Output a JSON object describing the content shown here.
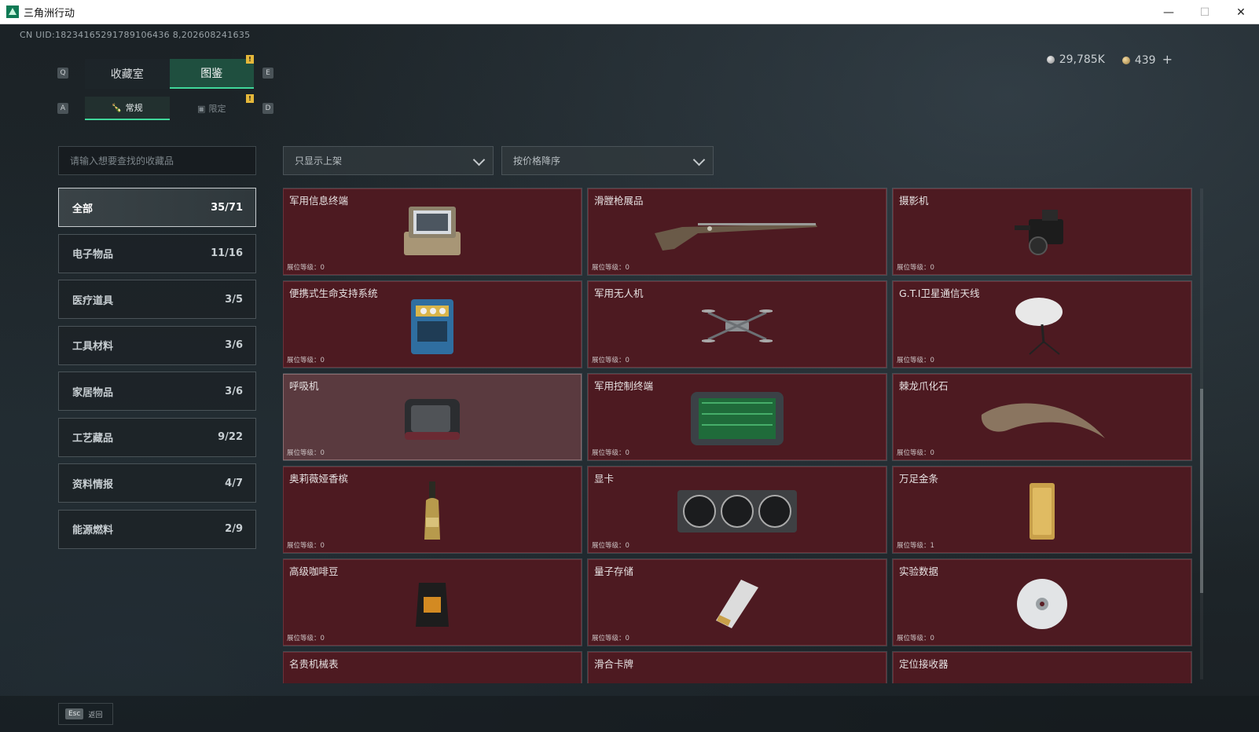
{
  "window": {
    "title": "三角洲行动",
    "minimize": "—",
    "maximize": "☐",
    "close": "✕"
  },
  "uid": "CN UID:18234165291789106436 8,202608241635",
  "currency": {
    "silver": "29,785K",
    "gold": "439",
    "add": "+"
  },
  "keys": {
    "q": "Q",
    "e": "E",
    "a": "A",
    "d": "D"
  },
  "tabs": [
    {
      "label": "收藏室",
      "active": false
    },
    {
      "label": "图鉴",
      "active": true
    }
  ],
  "tab_notice": "!",
  "subtabs": [
    {
      "label": "常规",
      "active": true
    },
    {
      "label": "限定",
      "active": false
    }
  ],
  "subtab_notice": "!",
  "search": {
    "placeholder": "请输入想要查找的收藏品"
  },
  "filters": {
    "shelf": "只显示上架",
    "sort": "按价格降序"
  },
  "categories": [
    {
      "label": "全部",
      "count": "35/71"
    },
    {
      "label": "电子物品",
      "count": "11/16"
    },
    {
      "label": "医疗道具",
      "count": "3/5"
    },
    {
      "label": "工具材料",
      "count": "3/6"
    },
    {
      "label": "家居物品",
      "count": "3/6"
    },
    {
      "label": "工艺藏品",
      "count": "9/22"
    },
    {
      "label": "资料情报",
      "count": "4/7"
    },
    {
      "label": "能源燃料",
      "count": "2/9"
    }
  ],
  "items": [
    {
      "name": "军用信息终端",
      "level": "展位等级：0",
      "icon": "terminal-case-icon"
    },
    {
      "name": "滑膛枪展品",
      "level": "展位等级：0",
      "icon": "musket-icon"
    },
    {
      "name": "摄影机",
      "level": "展位等级：0",
      "icon": "camera-icon"
    },
    {
      "name": "便携式生命支持系统",
      "level": "展位等级：0",
      "icon": "life-support-icon"
    },
    {
      "name": "军用无人机",
      "level": "展位等级：0",
      "icon": "drone-icon"
    },
    {
      "name": "G.T.I卫星通信天线",
      "level": "展位等级：0",
      "icon": "satellite-dish-icon"
    },
    {
      "name": "呼吸机",
      "level": "展位等级：0",
      "icon": "ventilator-icon"
    },
    {
      "name": "军用控制终端",
      "level": "展位等级：0",
      "icon": "control-terminal-icon"
    },
    {
      "name": "棘龙爪化石",
      "level": "展位等级：0",
      "icon": "claw-fossil-icon"
    },
    {
      "name": "奥莉薇娅香槟",
      "level": "展位等级：0",
      "icon": "champagne-icon"
    },
    {
      "name": "显卡",
      "level": "展位等级：0",
      "icon": "graphics-card-icon"
    },
    {
      "name": "万足金条",
      "level": "展位等级：1",
      "icon": "gold-bar-icon"
    },
    {
      "name": "高级咖啡豆",
      "level": "展位等级：0",
      "icon": "coffee-bag-icon"
    },
    {
      "name": "量子存储",
      "level": "展位等级：0",
      "icon": "quantum-storage-icon"
    },
    {
      "name": "实验数据",
      "level": "展位等级：0",
      "icon": "disc-icon"
    },
    {
      "name": "名贵机械表",
      "level": "",
      "icon": ""
    },
    {
      "name": "滑合卡牌",
      "level": "",
      "icon": ""
    },
    {
      "name": "定位接收器",
      "level": "",
      "icon": ""
    }
  ],
  "footer": {
    "esc": "Esc",
    "back": "返回"
  },
  "colors": {
    "card_bg": "#4d1a21",
    "card_highlight": "#5a3a3f",
    "accent": "#3fd79a",
    "notice": "#e5b83a"
  }
}
